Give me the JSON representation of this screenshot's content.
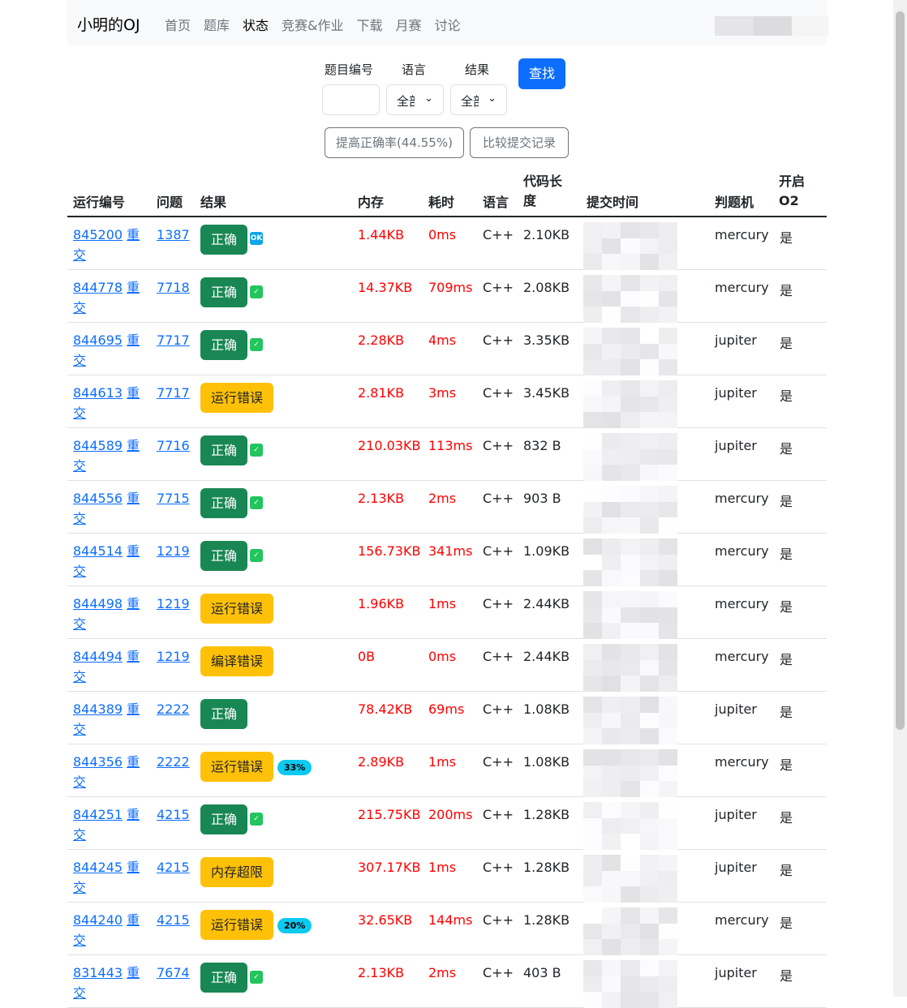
{
  "nav": {
    "brand": "小明的OJ",
    "links": [
      "首页",
      "题库",
      "状态",
      "竞赛&作业",
      "下载",
      "月赛",
      "讨论"
    ],
    "active": 2
  },
  "filters": {
    "problem_label": "题目编号",
    "problem_value": "",
    "lang_label": "语言",
    "lang_value": "全部",
    "result_label": "结果",
    "result_value": "全部",
    "search": "查找",
    "improve": "提高正确率(44.55%)",
    "compare": "比较提交记录"
  },
  "headers": {
    "id": "运行编号",
    "problem": "问题",
    "result": "结果",
    "memory": "内存",
    "time": "耗时",
    "lang": "语言",
    "code_len": "代码长度",
    "submit_time": "提交时间",
    "judger": "判题机",
    "o2": "开启O2"
  },
  "rejudge": "重交",
  "rows": [
    {
      "id": "845200",
      "problem": "1387",
      "result": "正确",
      "status": "ok",
      "extra": "ok-icon",
      "memory": "1.44KB",
      "time": "0ms",
      "lang": "C++",
      "len": "2.10KB",
      "judger": "mercury",
      "o2": "是"
    },
    {
      "id": "844778",
      "problem": "7718",
      "result": "正确",
      "status": "ok",
      "extra": "check-icon",
      "memory": "14.37KB",
      "time": "709ms",
      "lang": "C++",
      "len": "2.08KB",
      "judger": "mercury",
      "o2": "是"
    },
    {
      "id": "844695",
      "problem": "7717",
      "result": "正确",
      "status": "ok",
      "extra": "check-icon",
      "memory": "2.28KB",
      "time": "4ms",
      "lang": "C++",
      "len": "3.35KB",
      "judger": "jupiter",
      "o2": "是"
    },
    {
      "id": "844613",
      "problem": "7717",
      "result": "运行错误",
      "status": "warn",
      "extra": "",
      "memory": "2.81KB",
      "time": "3ms",
      "lang": "C++",
      "len": "3.45KB",
      "judger": "jupiter",
      "o2": "是"
    },
    {
      "id": "844589",
      "problem": "7716",
      "result": "正确",
      "status": "ok",
      "extra": "check-icon",
      "memory": "210.03KB",
      "time": "113ms",
      "lang": "C++",
      "len": "832 B",
      "judger": "jupiter",
      "o2": "是"
    },
    {
      "id": "844556",
      "problem": "7715",
      "result": "正确",
      "status": "ok",
      "extra": "check-icon",
      "memory": "2.13KB",
      "time": "2ms",
      "lang": "C++",
      "len": "903 B",
      "judger": "mercury",
      "o2": "是"
    },
    {
      "id": "844514",
      "problem": "1219",
      "result": "正确",
      "status": "ok",
      "extra": "check-icon",
      "memory": "156.73KB",
      "time": "341ms",
      "lang": "C++",
      "len": "1.09KB",
      "judger": "mercury",
      "o2": "是"
    },
    {
      "id": "844498",
      "problem": "1219",
      "result": "运行错误",
      "status": "warn",
      "extra": "",
      "memory": "1.96KB",
      "time": "1ms",
      "lang": "C++",
      "len": "2.44KB",
      "judger": "mercury",
      "o2": "是"
    },
    {
      "id": "844494",
      "problem": "1219",
      "result": "编译错误",
      "status": "warn",
      "extra": "",
      "memory": "0B",
      "time": "0ms",
      "lang": "C++",
      "len": "2.44KB",
      "judger": "mercury",
      "o2": "是"
    },
    {
      "id": "844389",
      "problem": "2222",
      "result": "正确",
      "status": "ok",
      "extra": "",
      "memory": "78.42KB",
      "time": "69ms",
      "lang": "C++",
      "len": "1.08KB",
      "judger": "jupiter",
      "o2": "是"
    },
    {
      "id": "844356",
      "problem": "2222",
      "result": "运行错误",
      "status": "warn",
      "extra": "33%",
      "memory": "2.89KB",
      "time": "1ms",
      "lang": "C++",
      "len": "1.08KB",
      "judger": "mercury",
      "o2": "是"
    },
    {
      "id": "844251",
      "problem": "4215",
      "result": "正确",
      "status": "ok",
      "extra": "check-icon",
      "memory": "215.75KB",
      "time": "200ms",
      "lang": "C++",
      "len": "1.28KB",
      "judger": "jupiter",
      "o2": "是"
    },
    {
      "id": "844245",
      "problem": "4215",
      "result": "内存超限",
      "status": "warn",
      "extra": "",
      "memory": "307.17KB",
      "time": "1ms",
      "lang": "C++",
      "len": "1.28KB",
      "judger": "jupiter",
      "o2": "是"
    },
    {
      "id": "844240",
      "problem": "4215",
      "result": "运行错误",
      "status": "warn",
      "extra": "20%",
      "memory": "32.65KB",
      "time": "144ms",
      "lang": "C++",
      "len": "1.28KB",
      "judger": "mercury",
      "o2": "是"
    },
    {
      "id": "831443",
      "problem": "7674",
      "result": "正确",
      "status": "ok",
      "extra": "check-icon",
      "memory": "2.13KB",
      "time": "2ms",
      "lang": "C++",
      "len": "403 B",
      "judger": "jupiter",
      "o2": "是"
    }
  ],
  "colors": {
    "primary": "#0d6efd",
    "success": "#198754",
    "warning": "#ffc107",
    "info": "#0dcaf0",
    "danger": "#ff0000"
  }
}
